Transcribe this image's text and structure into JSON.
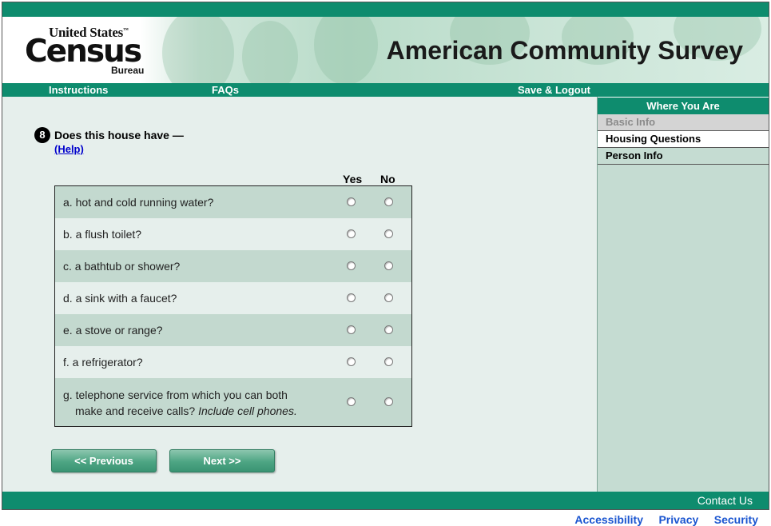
{
  "header": {
    "logo": {
      "line1": "United States",
      "tm": "™",
      "line2": "Census",
      "line3": "Bureau"
    },
    "title": "American Community Survey"
  },
  "nav": {
    "instructions": "Instructions",
    "faqs": "FAQs",
    "save_logout": "Save & Logout"
  },
  "sidebar": {
    "heading": "Where You Are",
    "items": [
      {
        "label": "Basic Info",
        "state": "completed"
      },
      {
        "label": "Housing Questions",
        "state": "current"
      },
      {
        "label": "Person Info",
        "state": "upcoming"
      }
    ]
  },
  "question": {
    "number": "8",
    "text": "Does this house have —",
    "help": "(Help)",
    "col_yes": "Yes",
    "col_no": "No",
    "rows": [
      {
        "label": "a. hot and cold running water?"
      },
      {
        "label": "b. a flush toilet?"
      },
      {
        "label": "c. a bathtub or shower?"
      },
      {
        "label": "d. a sink with a faucet?"
      },
      {
        "label": "e. a stove or range?"
      },
      {
        "label": "f. a refrigerator?"
      },
      {
        "label_line1": "g. telephone service from which you can both",
        "label_line2": "make and receive calls?",
        "label_italic": "Include cell phones."
      }
    ]
  },
  "buttons": {
    "previous": "<<   Previous",
    "next": "Next   >>"
  },
  "footer": {
    "contact": "Contact Us",
    "links": [
      "Accessibility",
      "Privacy",
      "Security"
    ]
  },
  "colors": {
    "brand_green": "#0e8c6e",
    "sidebar_bg": "#c5dcd2",
    "row_dark": "#c3d9cf",
    "link_blue": "#1a55d0"
  }
}
